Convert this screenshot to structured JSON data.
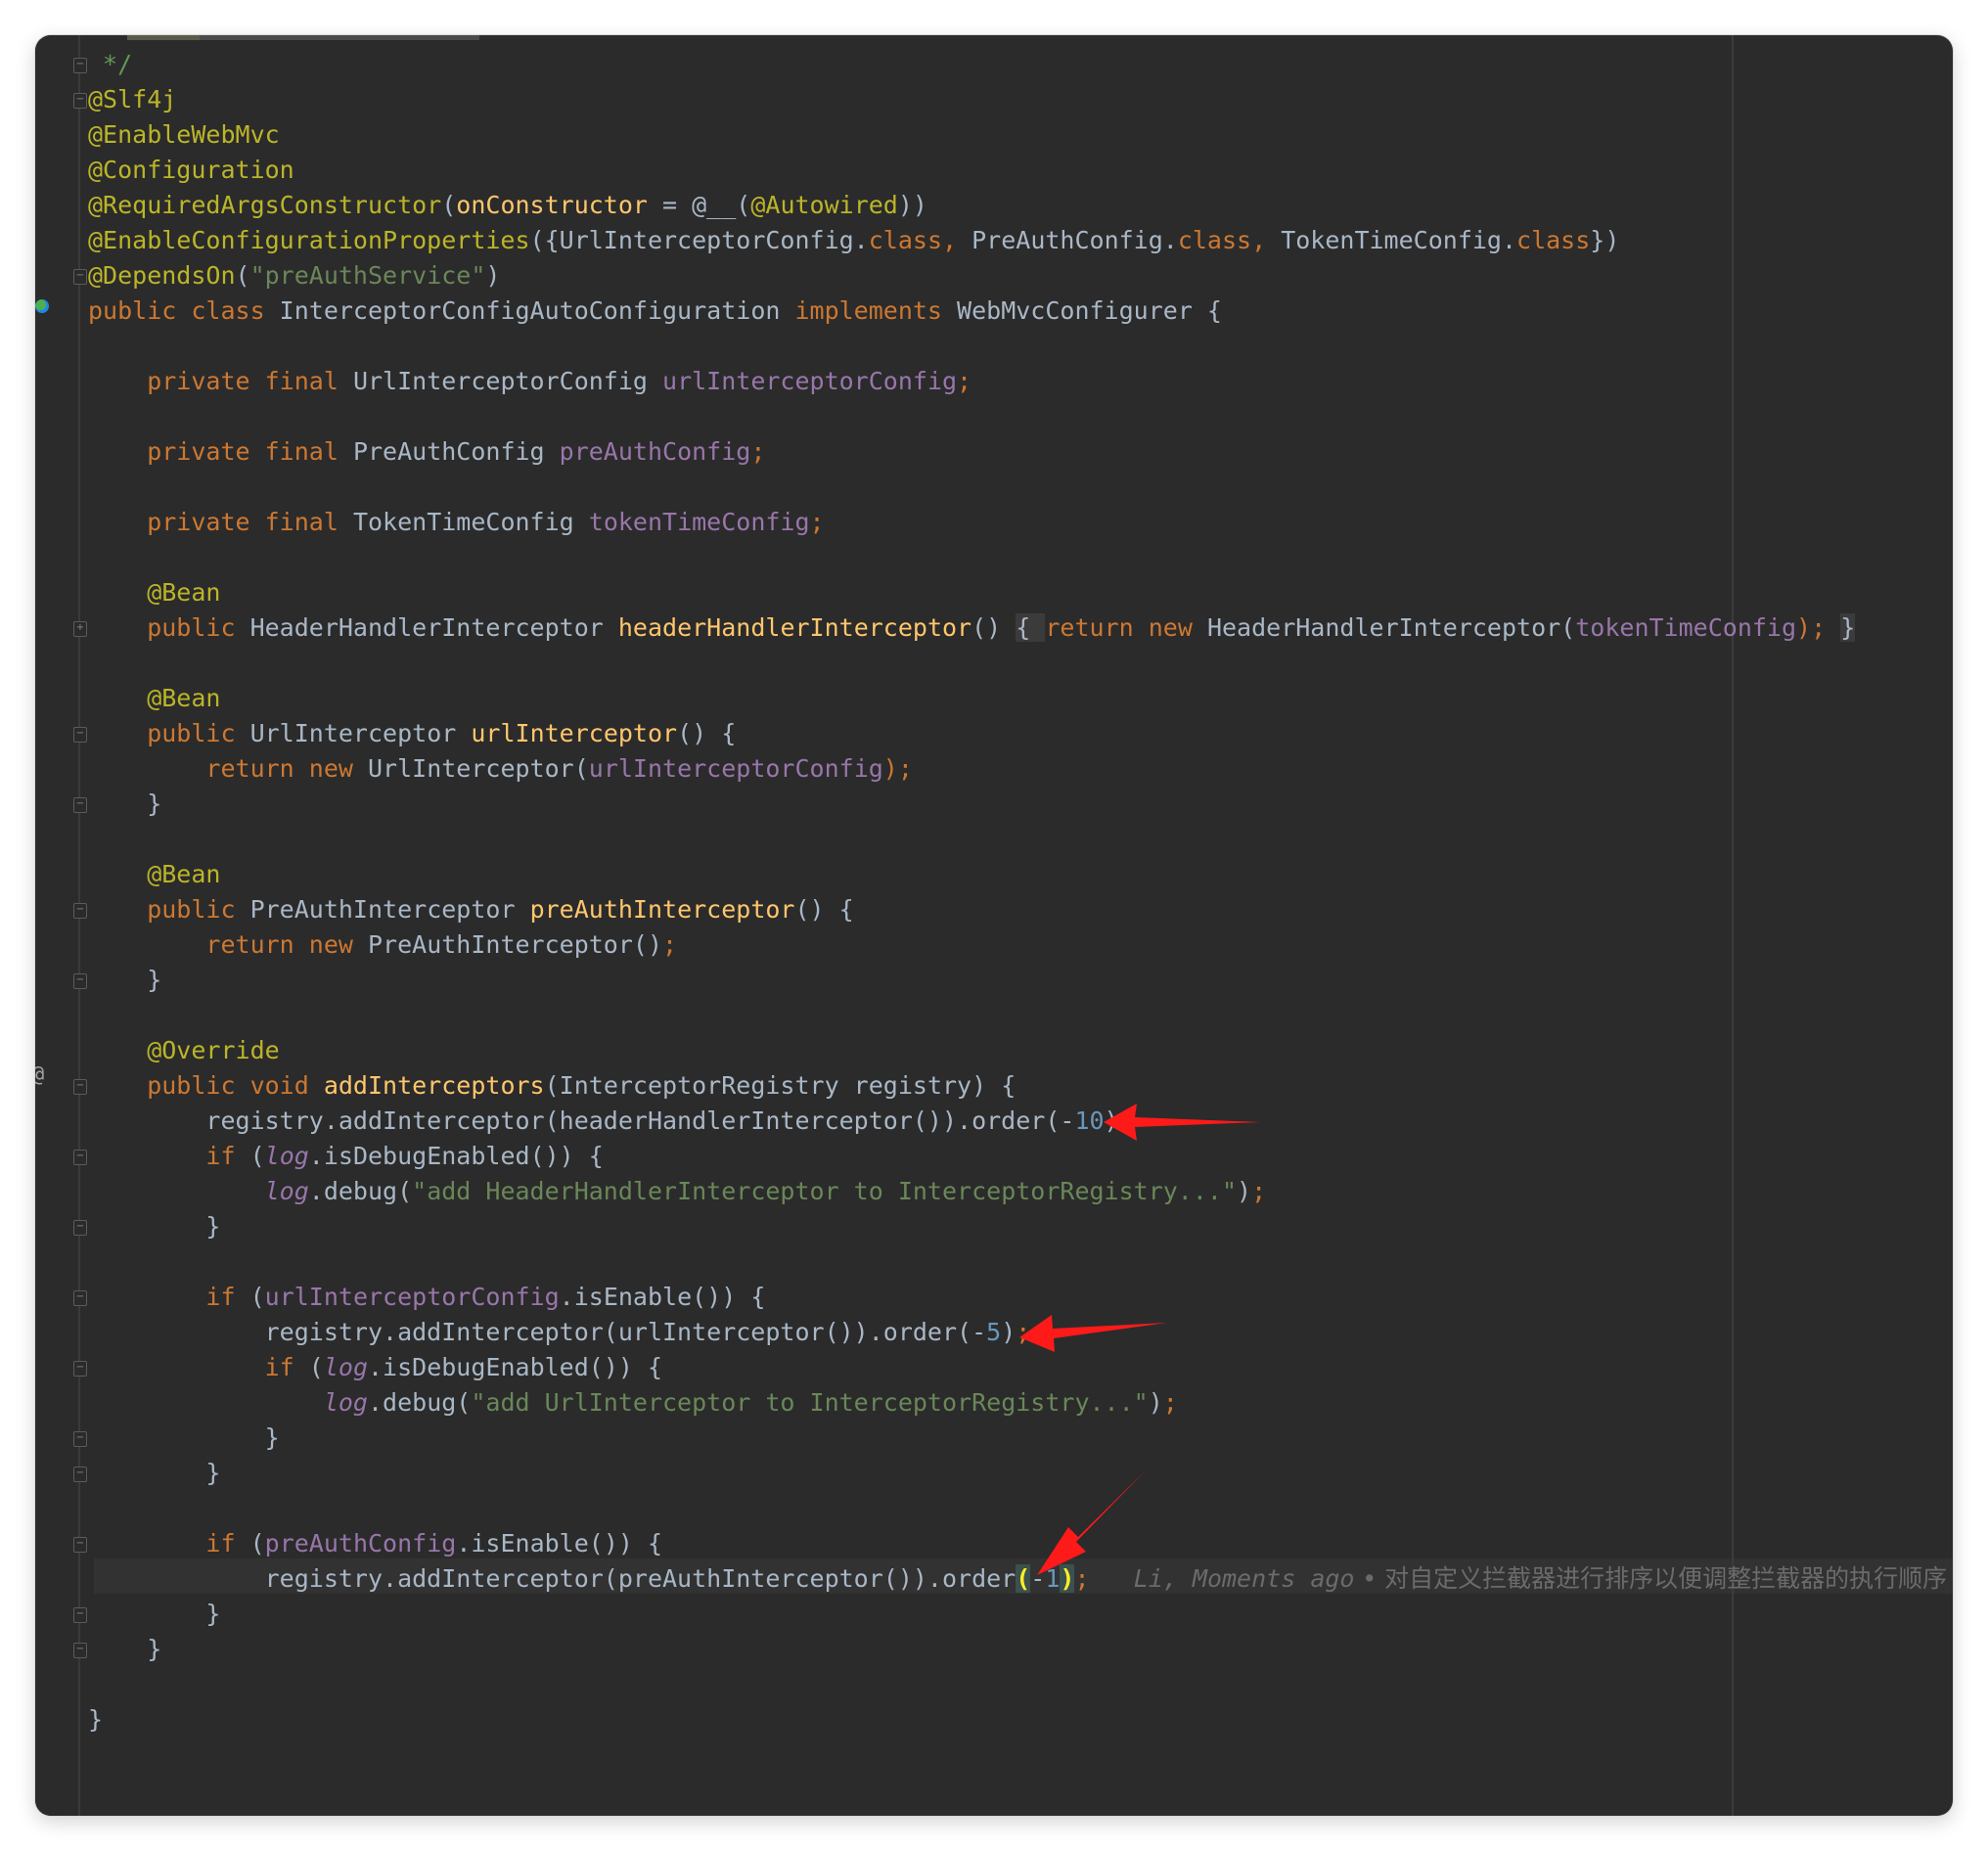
{
  "editor": {
    "lines": [
      [
        {
          "t": " */",
          "c": "cmt"
        }
      ],
      [
        {
          "t": "@Slf4j",
          "c": "ann"
        }
      ],
      [
        {
          "t": "@EnableWebMvc",
          "c": "ann"
        }
      ],
      [
        {
          "t": "@Configuration",
          "c": "ann"
        }
      ],
      [
        {
          "t": "@RequiredArgsConstructor",
          "c": "ann"
        },
        {
          "t": "(",
          "c": "plain"
        },
        {
          "t": "onConstructor",
          "c": "fn"
        },
        {
          "t": " = ",
          "c": "plain"
        },
        {
          "t": "@__",
          "c": "plain"
        },
        {
          "t": "(",
          "c": "plain"
        },
        {
          "t": "@Autowired",
          "c": "ann"
        },
        {
          "t": "))",
          "c": "plain"
        }
      ],
      [
        {
          "t": "@EnableConfigurationProperties",
          "c": "ann"
        },
        {
          "t": "({UrlInterceptorConfig.",
          "c": "plain"
        },
        {
          "t": "class",
          "c": "kw"
        },
        {
          "t": ", ",
          "c": "kw"
        },
        {
          "t": "PreAuthConfig.",
          "c": "plain"
        },
        {
          "t": "class",
          "c": "kw"
        },
        {
          "t": ", ",
          "c": "kw"
        },
        {
          "t": "TokenTimeConfig.",
          "c": "plain"
        },
        {
          "t": "class",
          "c": "kw"
        },
        {
          "t": "})",
          "c": "plain"
        }
      ],
      [
        {
          "t": "@DependsOn",
          "c": "ann"
        },
        {
          "t": "(",
          "c": "plain"
        },
        {
          "t": "\"preAuthService\"",
          "c": "str"
        },
        {
          "t": ")",
          "c": "plain"
        }
      ],
      [
        {
          "t": "public class ",
          "c": "kw"
        },
        {
          "t": "InterceptorConfigAutoConfiguration ",
          "c": "plain"
        },
        {
          "t": "implements ",
          "c": "kw"
        },
        {
          "t": "WebMvcConfigurer {",
          "c": "plain"
        }
      ],
      [],
      [
        {
          "t": "    private final ",
          "c": "kw"
        },
        {
          "t": "UrlInterceptorConfig ",
          "c": "plain"
        },
        {
          "t": "urlInterceptorConfig",
          "c": "fld"
        },
        {
          "t": ";",
          "c": "kw"
        }
      ],
      [],
      [
        {
          "t": "    private final ",
          "c": "kw"
        },
        {
          "t": "PreAuthConfig ",
          "c": "plain"
        },
        {
          "t": "preAuthConfig",
          "c": "fld"
        },
        {
          "t": ";",
          "c": "kw"
        }
      ],
      [],
      [
        {
          "t": "    private final ",
          "c": "kw"
        },
        {
          "t": "TokenTimeConfig ",
          "c": "plain"
        },
        {
          "t": "tokenTimeConfig",
          "c": "fld"
        },
        {
          "t": ";",
          "c": "kw"
        }
      ],
      [],
      [
        {
          "t": "    @Bean",
          "c": "ann"
        }
      ],
      [
        {
          "t": "    public ",
          "c": "kw"
        },
        {
          "t": "HeaderHandlerInterceptor ",
          "c": "plain"
        },
        {
          "t": "headerHandlerInterceptor",
          "c": "fn"
        },
        {
          "t": "() ",
          "c": "plain"
        },
        {
          "t": "{ ",
          "c": "plain fold"
        },
        {
          "t": "return new ",
          "c": "kw"
        },
        {
          "t": "HeaderHandlerInterceptor(",
          "c": "plain"
        },
        {
          "t": "tokenTimeConfig",
          "c": "fld"
        },
        {
          "t": "); ",
          "c": "kw"
        },
        {
          "t": "}",
          "c": "plain fold"
        }
      ],
      [],
      [
        {
          "t": "    @Bean",
          "c": "ann"
        }
      ],
      [
        {
          "t": "    public ",
          "c": "kw"
        },
        {
          "t": "UrlInterceptor ",
          "c": "plain"
        },
        {
          "t": "urlInterceptor",
          "c": "fn"
        },
        {
          "t": "() {",
          "c": "plain"
        }
      ],
      [
        {
          "t": "        return new ",
          "c": "kw"
        },
        {
          "t": "UrlInterceptor(",
          "c": "plain"
        },
        {
          "t": "urlInterceptorConfig",
          "c": "fld"
        },
        {
          "t": ");",
          "c": "kw"
        }
      ],
      [
        {
          "t": "    }",
          "c": "plain"
        }
      ],
      [],
      [
        {
          "t": "    @Bean",
          "c": "ann"
        }
      ],
      [
        {
          "t": "    public ",
          "c": "kw"
        },
        {
          "t": "PreAuthInterceptor ",
          "c": "plain"
        },
        {
          "t": "preAuthInterceptor",
          "c": "fn"
        },
        {
          "t": "() {",
          "c": "plain"
        }
      ],
      [
        {
          "t": "        return new ",
          "c": "kw"
        },
        {
          "t": "PreAuthInterceptor()",
          "c": "plain"
        },
        {
          "t": ";",
          "c": "kw"
        }
      ],
      [
        {
          "t": "    }",
          "c": "plain"
        }
      ],
      [],
      [
        {
          "t": "    @Override",
          "c": "ann"
        }
      ],
      [
        {
          "t": "    public void ",
          "c": "kw"
        },
        {
          "t": "addInterceptors",
          "c": "fn"
        },
        {
          "t": "(InterceptorRegistry registry) {",
          "c": "plain"
        }
      ],
      [
        {
          "t": "        registry.addInterceptor(headerHandlerInterceptor()).order(-",
          "c": "plain"
        },
        {
          "t": "10",
          "c": "num"
        },
        {
          "t": ")",
          "c": "plain"
        },
        {
          "t": ";",
          "c": "kw"
        }
      ],
      [
        {
          "t": "        if ",
          "c": "kw"
        },
        {
          "t": "(",
          "c": "plain"
        },
        {
          "t": "log",
          "c": "fld it"
        },
        {
          "t": ".isDebugEnabled()) {",
          "c": "plain"
        }
      ],
      [
        {
          "t": "            ",
          "c": "plain"
        },
        {
          "t": "log",
          "c": "fld it"
        },
        {
          "t": ".debug(",
          "c": "plain"
        },
        {
          "t": "\"add HeaderHandlerInterceptor to InterceptorRegistry...\"",
          "c": "str"
        },
        {
          "t": ")",
          "c": "plain"
        },
        {
          "t": ";",
          "c": "kw"
        }
      ],
      [
        {
          "t": "        }",
          "c": "plain"
        }
      ],
      [],
      [
        {
          "t": "        if ",
          "c": "kw"
        },
        {
          "t": "(",
          "c": "plain"
        },
        {
          "t": "urlInterceptorConfig",
          "c": "fld"
        },
        {
          "t": ".isEnable()) {",
          "c": "plain"
        }
      ],
      [
        {
          "t": "            registry.addInterceptor(urlInterceptor()).order(-",
          "c": "plain"
        },
        {
          "t": "5",
          "c": "num"
        },
        {
          "t": ")",
          "c": "plain"
        },
        {
          "t": ";",
          "c": "kw"
        }
      ],
      [
        {
          "t": "            if ",
          "c": "kw"
        },
        {
          "t": "(",
          "c": "plain"
        },
        {
          "t": "log",
          "c": "fld it"
        },
        {
          "t": ".isDebugEnabled()) {",
          "c": "plain"
        }
      ],
      [
        {
          "t": "                ",
          "c": "plain"
        },
        {
          "t": "log",
          "c": "fld it"
        },
        {
          "t": ".debug(",
          "c": "plain"
        },
        {
          "t": "\"add UrlInterceptor to InterceptorRegistry...\"",
          "c": "str"
        },
        {
          "t": ")",
          "c": "plain"
        },
        {
          "t": ";",
          "c": "kw"
        }
      ],
      [
        {
          "t": "            }",
          "c": "plain"
        }
      ],
      [
        {
          "t": "        }",
          "c": "plain"
        }
      ],
      [],
      [
        {
          "t": "        if ",
          "c": "kw"
        },
        {
          "t": "(",
          "c": "plain"
        },
        {
          "t": "preAuthConfig",
          "c": "fld"
        },
        {
          "t": ".isEnable()) {",
          "c": "plain"
        }
      ],
      [
        {
          "t": "            registry.addInterceptor(preAuthInterceptor()).order",
          "c": "plain"
        },
        {
          "t": "(",
          "c": "brace"
        },
        {
          "t": "-",
          "c": "plain"
        },
        {
          "t": "1",
          "c": "num"
        },
        {
          "t": ")",
          "c": "brace"
        },
        {
          "t": ";",
          "c": "kw"
        },
        {
          "t": "   Li, Moments ago",
          "c": "blame"
        },
        {
          "t": " • 对自定义拦截器进行排序以便调整拦截器的执行顺序",
          "c": "blame-msg"
        }
      ],
      [
        {
          "t": "        }",
          "c": "plain"
        }
      ],
      [
        {
          "t": "    }",
          "c": "plain"
        }
      ],
      [],
      [
        {
          "t": "}",
          "c": "plain"
        }
      ]
    ]
  },
  "colors": {
    "background": "#2b2b2b",
    "keyword": "#cc7832",
    "annotation": "#bbb529",
    "string": "#6a8759",
    "field": "#9876aa",
    "method": "#ffc66d",
    "number": "#6897bb",
    "text": "#a9b7c6",
    "arrow": "#ff1a1a"
  }
}
